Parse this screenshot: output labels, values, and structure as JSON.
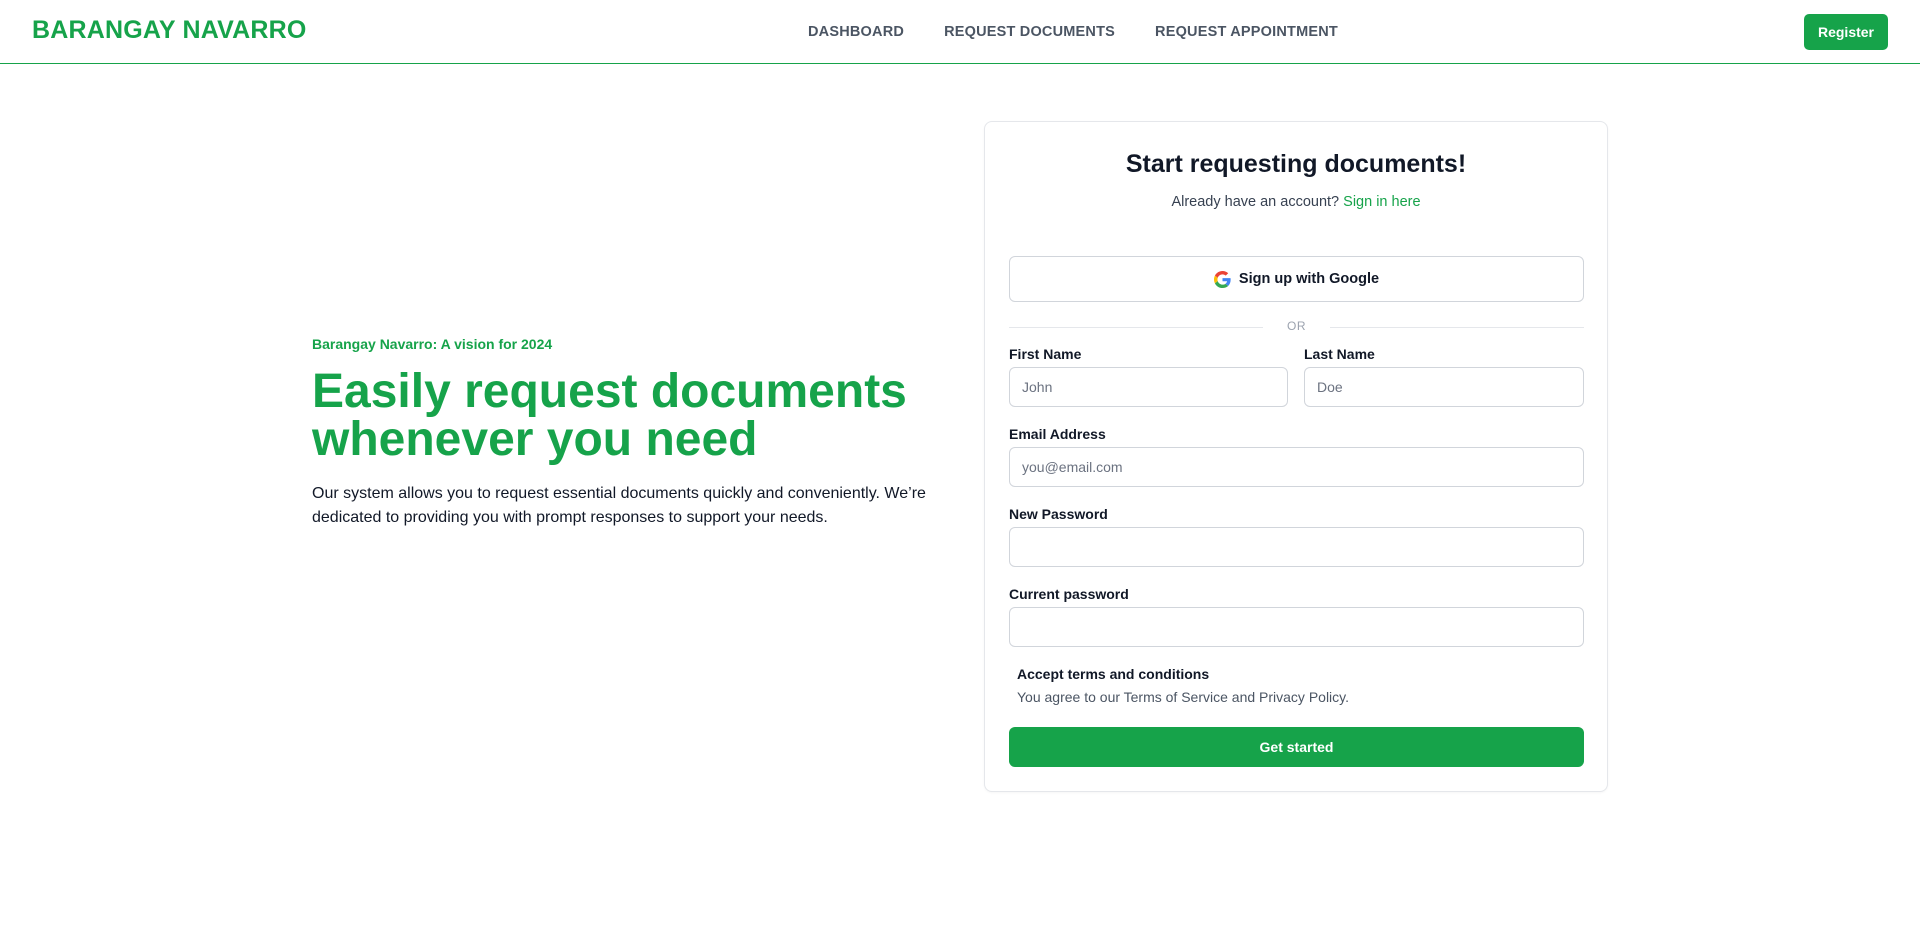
{
  "header": {
    "brand": "BARANGAY NAVARRO",
    "nav": [
      "DASHBOARD",
      "REQUEST DOCUMENTS",
      "REQUEST APPOINTMENT"
    ],
    "register_label": "Register"
  },
  "hero": {
    "eyebrow": "Barangay Navarro: A vision for 2024",
    "title": "Easily request documents whenever you need",
    "description": "Our system allows you to request essential documents quickly and conveniently. We’re dedicated to providing you with prompt responses to support your needs."
  },
  "form": {
    "title": "Start requesting documents!",
    "account_prompt": "Already have an account?",
    "sign_in_link": "Sign in here",
    "google_label": "Sign up with Google",
    "divider": "OR",
    "first_name": {
      "label": "First Name",
      "placeholder": "John",
      "value": ""
    },
    "last_name": {
      "label": "Last Name",
      "placeholder": "Doe",
      "value": ""
    },
    "email": {
      "label": "Email Address",
      "placeholder": "you@email.com",
      "value": ""
    },
    "new_password": {
      "label": "New Password",
      "placeholder": "",
      "value": ""
    },
    "current_password": {
      "label": "Current password",
      "placeholder": "",
      "value": ""
    },
    "terms_title": "Accept terms and conditions",
    "terms_text": "You agree to our Terms of Service and Privacy Policy.",
    "submit_label": "Get started"
  },
  "colors": {
    "accent": "#16a34a",
    "nav_text": "#4b5563",
    "border": "#d1d5db"
  }
}
